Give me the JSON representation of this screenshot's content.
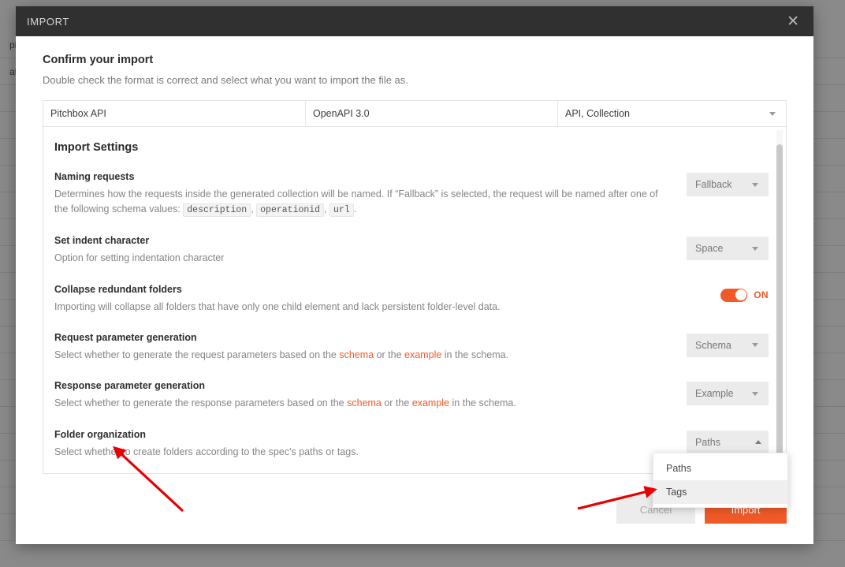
{
  "background": {
    "rows": [
      "pi.re",
      "atio",
      "",
      "",
      "",
      "",
      "",
      "",
      "",
      "",
      "",
      "",
      "",
      "",
      "",
      "",
      "",
      "",
      "",
      ""
    ]
  },
  "modal": {
    "title": "IMPORT",
    "close_icon": "close-icon",
    "close_glyph": "✕",
    "confirm_title": "Confirm your import",
    "confirm_subtitle": "Double check the format is correct and select what you want to import the file as.",
    "file_summary": {
      "name": "Pitchbox API",
      "format": "OpenAPI 3.0",
      "import_as": "API, Collection"
    },
    "settings": {
      "heading": "Import Settings",
      "items": [
        {
          "title": "Naming requests",
          "desc_part1": "Determines how the requests inside the generated collection will be named. If “Fallback” is selected, the request will be named after one of the following schema values: ",
          "code1": "description",
          "sep1": ", ",
          "code2": "operationid",
          "sep2": ", ",
          "code3": "url",
          "desc_end": ".",
          "control": "select",
          "value": "Fallback"
        },
        {
          "title": "Set indent character",
          "desc": "Option for setting indentation character",
          "control": "select",
          "value": "Space"
        },
        {
          "title": "Collapse redundant folders",
          "desc": "Importing will collapse all folders that have only one child element and lack persistent folder-level data.",
          "control": "toggle",
          "value": "ON"
        },
        {
          "title": "Request parameter generation",
          "desc_a": "Select whether to generate the request parameters based on the ",
          "link1": "schema",
          "desc_b": " or the ",
          "link2": "example",
          "desc_c": " in the schema.",
          "control": "select",
          "value": "Schema"
        },
        {
          "title": "Response parameter generation",
          "desc_a": "Select whether to generate the response parameters based on the ",
          "link1": "schema",
          "desc_b": " or the ",
          "link2": "example",
          "desc_c": " in the schema.",
          "control": "select",
          "value": "Example"
        },
        {
          "title": "Folder organization",
          "desc": "Select whether to create folders according to the spec's paths or tags.",
          "control": "select-open",
          "value": "Paths"
        }
      ]
    },
    "dropdown": {
      "options": [
        {
          "label": "Paths",
          "selected": false
        },
        {
          "label": "Tags",
          "selected": true
        }
      ]
    },
    "footer": {
      "cancel_label": "Cancel",
      "import_label": "Import"
    }
  },
  "colors": {
    "accent": "#f05a28",
    "header_bg": "#303030",
    "annotation": "#e60000"
  }
}
